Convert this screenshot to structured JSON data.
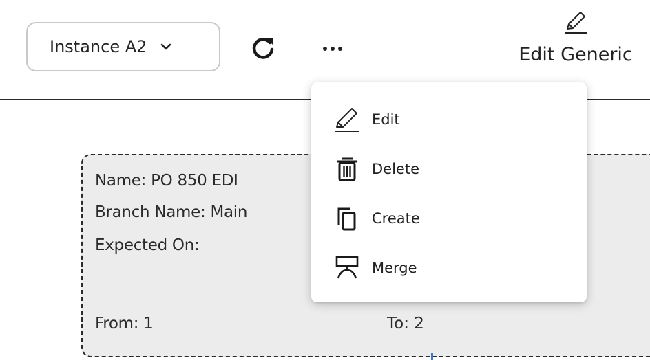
{
  "toolbar": {
    "instance_select": {
      "value": "Instance A2",
      "icon": "chevron-down-icon"
    },
    "refresh_icon": "refresh-icon",
    "more_icon": "more-horizontal-icon",
    "edit_generic": {
      "label": "Edit Generic",
      "icon": "pencil-icon"
    }
  },
  "card": {
    "name": "Name: PO 850 EDI",
    "branch": "Branch Name: Main",
    "expected": "Expected On:",
    "from": "From: 1",
    "to": "To: 2"
  },
  "menu": {
    "items": [
      {
        "label": "Edit",
        "icon": "pencil-icon"
      },
      {
        "label": "Delete",
        "icon": "trash-icon"
      },
      {
        "label": "Create",
        "icon": "copy-icon"
      },
      {
        "label": "Merge",
        "icon": "merge-icon"
      }
    ]
  },
  "colors": {
    "card_bg": "#ececec",
    "border": "#2a2a2a",
    "select_border": "#c9c9c9"
  }
}
